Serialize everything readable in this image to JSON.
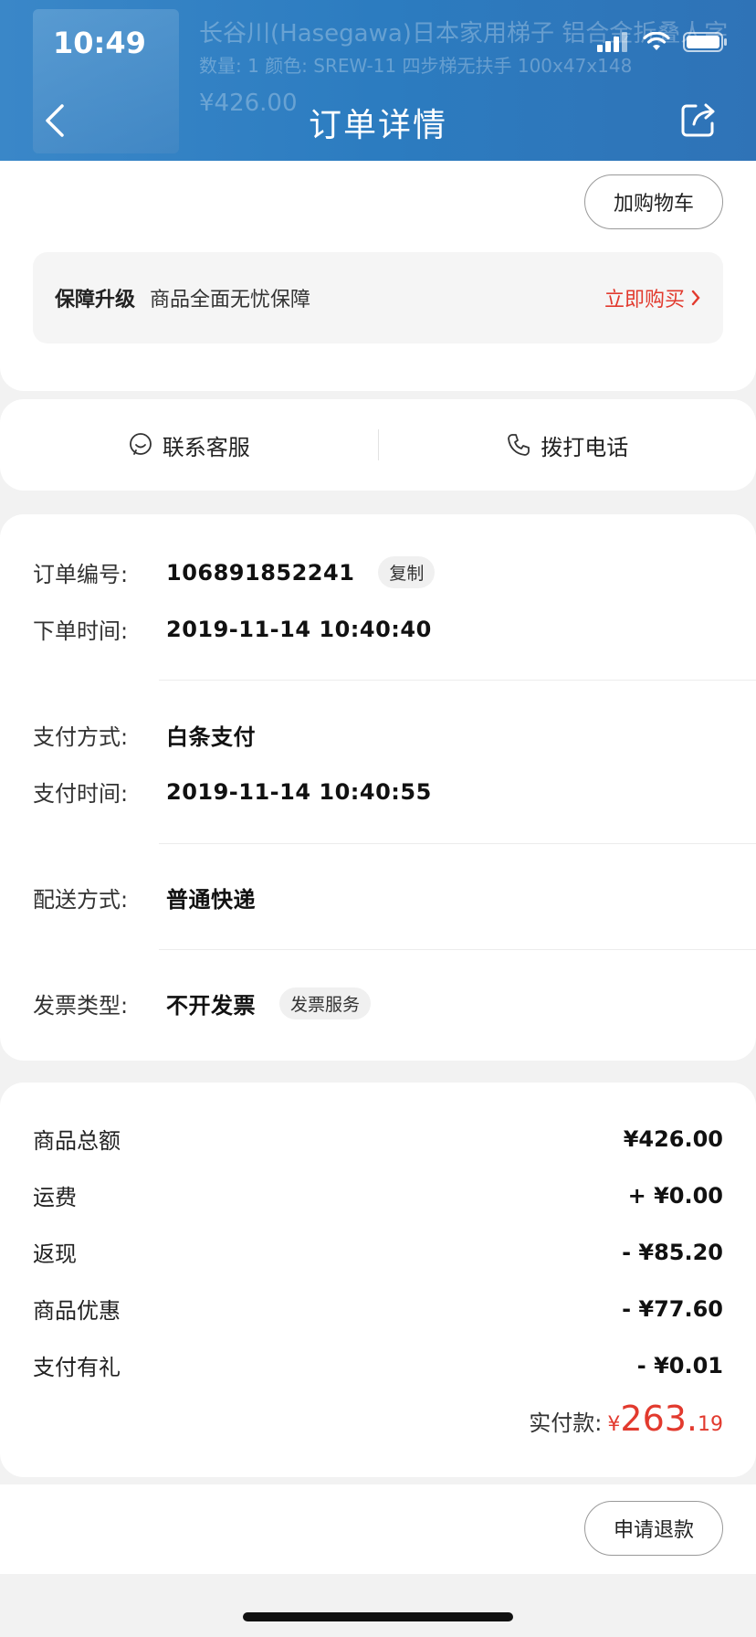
{
  "status_bar": {
    "time": "10:49"
  },
  "header": {
    "title": "订单详情",
    "ghost_title": "长谷川(Hasegawa)日本家用梯子 铝合金折叠人字",
    "ghost_spec": "数量: 1 颜色: SREW-11 四步梯无扶手 100x47x148",
    "ghost_price": "¥426.00"
  },
  "card": {
    "add_cart_label": "加购物车",
    "guarantee_label": "保障升级",
    "guarantee_text": "商品全面无忧保障",
    "guarantee_buy": "立即购买"
  },
  "contact": {
    "service_label": "联系客服",
    "phone_label": "拨打电话"
  },
  "order_info": {
    "order_no_label": "订单编号:",
    "order_no": "106891852241",
    "copy_label": "复制",
    "order_time_label": "下单时间:",
    "order_time": "2019-11-14 10:40:40",
    "pay_method_label": "支付方式:",
    "pay_method": "白条支付",
    "pay_time_label": "支付时间:",
    "pay_time": "2019-11-14 10:40:55",
    "delivery_label": "配送方式:",
    "delivery": "普通快递",
    "invoice_label": "发票类型:",
    "invoice": "不开发票",
    "invoice_service": "发票服务"
  },
  "money": {
    "rows": [
      {
        "label": "商品总额",
        "value": "¥426.00"
      },
      {
        "label": "运费",
        "value": "+ ¥0.00"
      },
      {
        "label": "返现",
        "value": "- ¥85.20"
      },
      {
        "label": "商品优惠",
        "value": "- ¥77.60"
      },
      {
        "label": "支付有礼",
        "value": "- ¥0.01"
      }
    ],
    "paid_label": "实付款:",
    "paid_currency": "¥",
    "paid_int": "263.",
    "paid_dec": "19"
  },
  "bottom": {
    "refund_label": "申请退款"
  },
  "colors": {
    "header_blue": "#2c7cc0",
    "accent_red": "#e23a2e"
  }
}
